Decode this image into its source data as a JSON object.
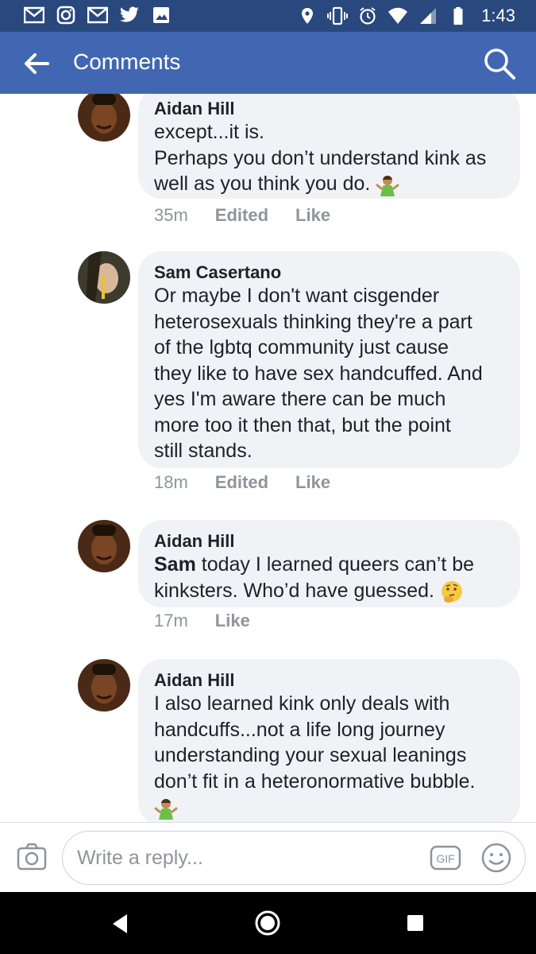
{
  "status_bar": {
    "time": "1:43",
    "left_icons": [
      "gmail-icon",
      "instagram-icon",
      "gmail-icon",
      "twitter-icon",
      "gallery-icon"
    ],
    "right_icons": [
      "location-icon",
      "vibrate-icon",
      "alarm-icon",
      "wifi-icon",
      "signal-icon",
      "battery-icon"
    ]
  },
  "app_bar": {
    "title": "Comments",
    "back_icon": "arrow-left-icon",
    "search_icon": "search-icon"
  },
  "comments": [
    {
      "author": "Aidan Hill",
      "lines": [
        "except...it is.",
        "Perhaps you don’t understand kink as",
        "well as you think you do."
      ],
      "emoji": "person-shrugging",
      "time": "35m",
      "edited": "Edited",
      "like": "Like"
    },
    {
      "author": "Sam Casertano",
      "lines": [
        "Or maybe I don't want cisgender",
        "heterosexuals thinking they're a part",
        "of the lgbtq community just cause",
        "they like to have sex handcuffed. And",
        "yes I'm aware there can be much",
        "more too it then that, but the point",
        "still stands."
      ],
      "time": "18m",
      "edited": "Edited",
      "like": "Like"
    },
    {
      "author": "Aidan Hill",
      "mention": "Sam",
      "line1_rest": " today I learned queers can’t be",
      "line2": "kinksters. Who’d have guessed.",
      "emoji": "thinking-face",
      "time": "17m",
      "like": "Like"
    },
    {
      "author": "Aidan Hill",
      "lines": [
        "I also learned kink only deals with",
        "handcuffs...not a life long journey",
        "understanding your sexual leanings",
        "don’t fit in a heteronormative bubble."
      ],
      "emoji": "person-shrugging"
    }
  ],
  "reply_bar": {
    "placeholder": "Write a reply...",
    "gif_label": "GIF",
    "camera_icon": "camera-icon",
    "smile_icon": "smiley-icon"
  },
  "colors": {
    "status_bar": "#29487d",
    "app_bar": "#4267b2",
    "bubble": "#f0f2f5",
    "meta_text": "#90949c"
  }
}
